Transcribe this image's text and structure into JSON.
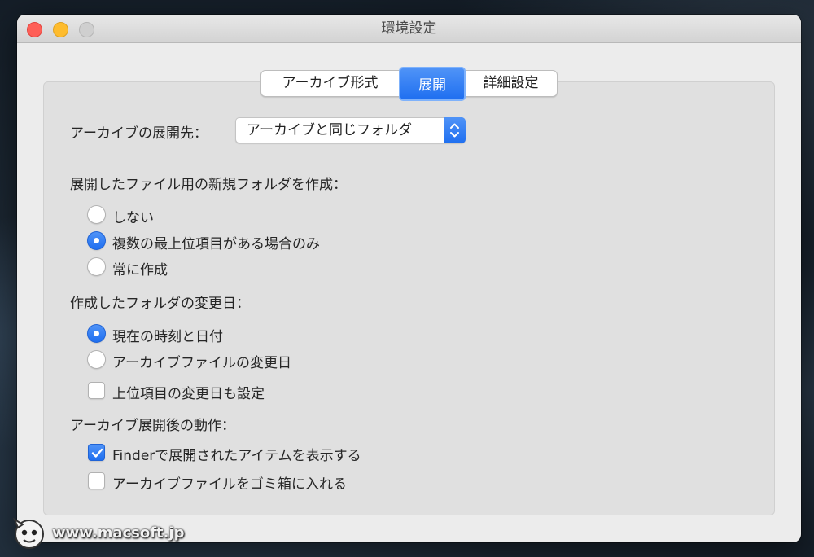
{
  "window": {
    "title": "環境設定"
  },
  "tabs": [
    {
      "label": "アーカイブ形式",
      "selected": false
    },
    {
      "label": "展開",
      "selected": true
    },
    {
      "label": "詳細設定",
      "selected": false
    }
  ],
  "destination": {
    "label": "アーカイブの展開先：",
    "value": "アーカイブと同じフォルダ"
  },
  "new_folder": {
    "label": "展開したファイル用の新規フォルダを作成：",
    "options": [
      {
        "label": "しない",
        "selected": false
      },
      {
        "label": "複数の最上位項目がある場合のみ",
        "selected": true
      },
      {
        "label": "常に作成",
        "selected": false
      }
    ]
  },
  "folder_date": {
    "label": "作成したフォルダの変更日：",
    "options": [
      {
        "label": "現在の時刻と日付",
        "selected": true
      },
      {
        "label": "アーカイブファイルの変更日",
        "selected": false
      }
    ],
    "top_level_checkbox": {
      "label": "上位項目の変更日も設定",
      "checked": false
    }
  },
  "after_expand": {
    "label": "アーカイブ展開後の動作：",
    "options": [
      {
        "label": "Finderで展開されたアイテムを表示する",
        "checked": true
      },
      {
        "label": "アーカイブファイルをゴミ箱に入れる",
        "checked": false
      }
    ]
  },
  "watermark": {
    "text": "www.macsoft.jp"
  },
  "colors": {
    "accent": "#1f6ff0",
    "window_bg": "#ececec"
  }
}
